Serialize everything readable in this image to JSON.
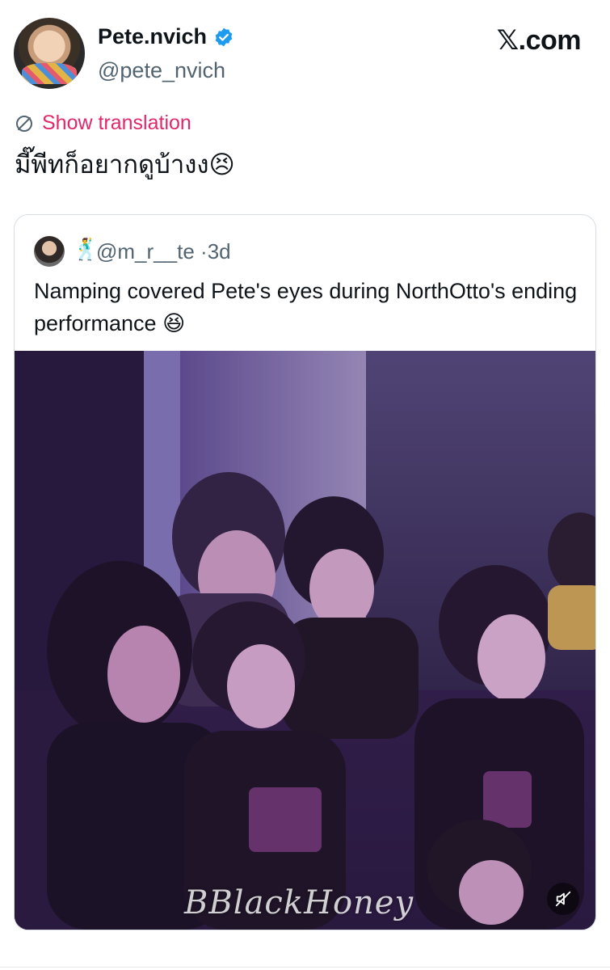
{
  "author": {
    "name": "Pete.nvich",
    "handle": "@pete_nvich",
    "verified": true
  },
  "brand": {
    "label": "𝕏.com"
  },
  "translation": {
    "icon": "translate-icon",
    "label": "Show translation"
  },
  "tweet": {
    "text": "มี๊พีทก็อยากดูบ้างง😣"
  },
  "quoted": {
    "emoji": "🕺",
    "handle": "@m_r__te",
    "time": "3d",
    "separator": "·",
    "text": "Namping covered Pete's eyes during NorthOtto's ending performance 😆",
    "media": {
      "type": "video",
      "watermark": "BBlackHoney",
      "mute_icon": "speaker-muted-icon"
    }
  },
  "colors": {
    "link_pink": "#e0296b",
    "secondary_text": "#536471",
    "verified_blue": "#1d9bf0",
    "border": "#d7dde2"
  }
}
